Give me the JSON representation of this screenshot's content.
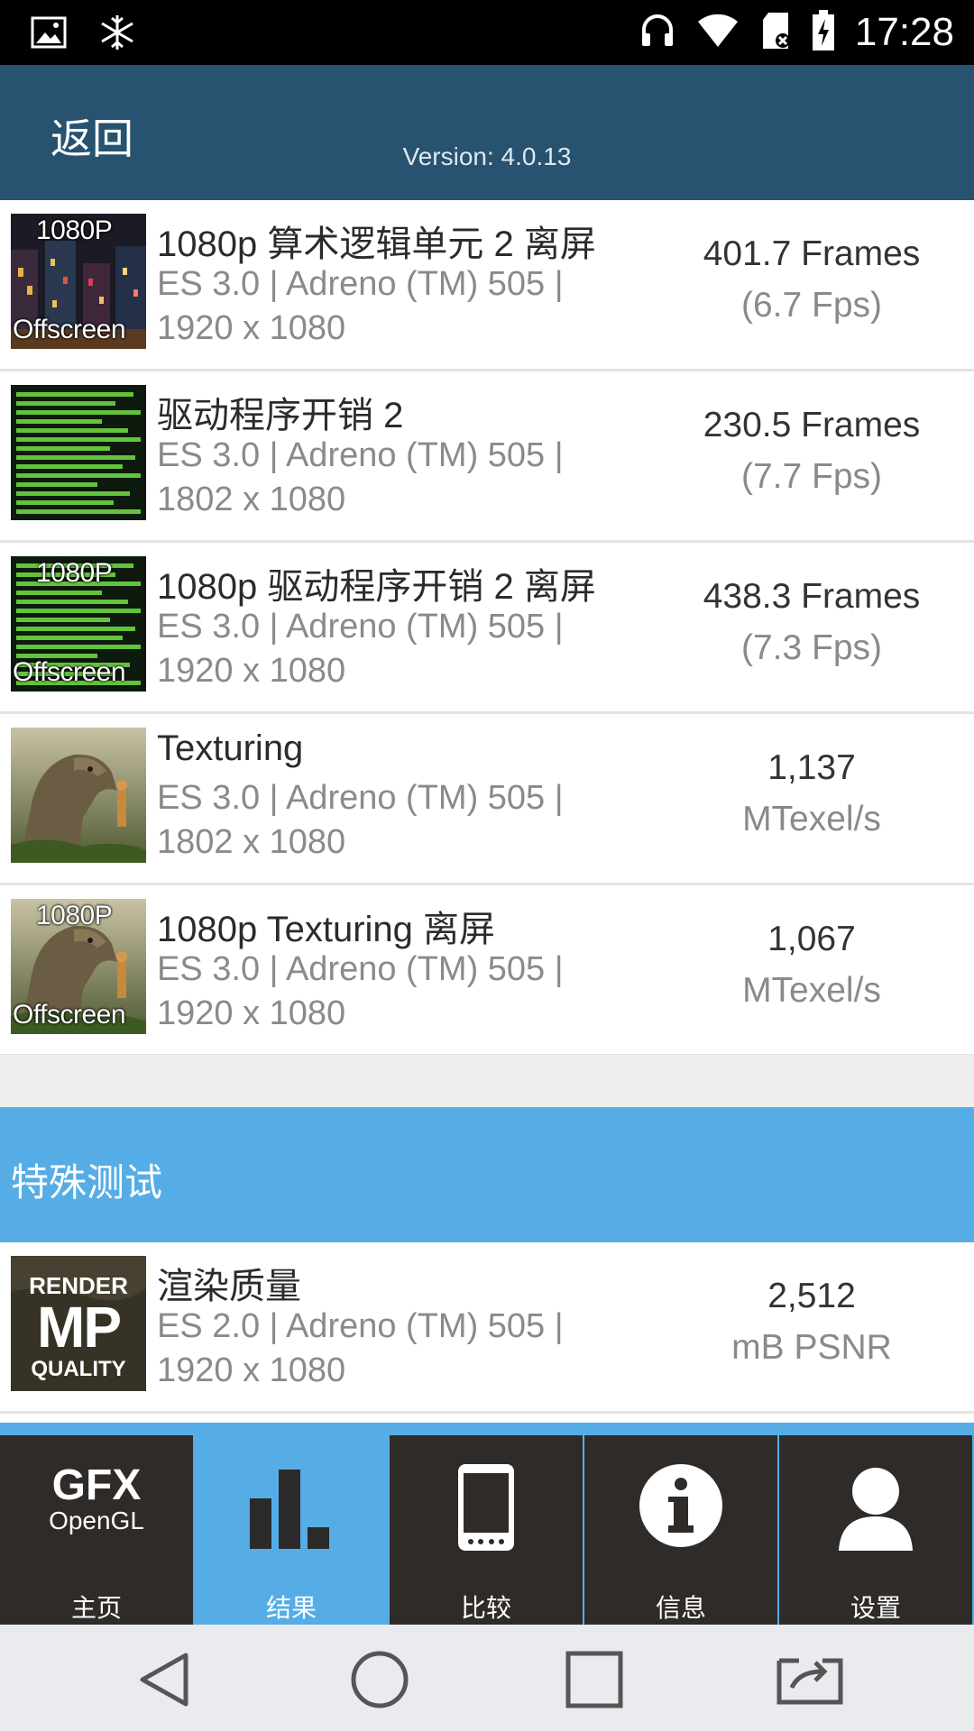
{
  "status_bar": {
    "time": "17:28",
    "icons": [
      "image-icon",
      "snowflake-icon",
      "headset-icon",
      "wifi-icon",
      "sd-card-icon",
      "battery-charging-icon"
    ]
  },
  "header": {
    "back_label": "返回",
    "version": "Version: 4.0.13"
  },
  "results": [
    {
      "title": "1080p 算术逻辑单元 2 离屏",
      "api": "ES 3.0 | Adreno (TM) 505 |",
      "resolution": "1920 x 1080",
      "value": "401.7 Frames",
      "unit": "(6.7 Fps)",
      "thumb": "city-night",
      "tag_top": "1080P",
      "tag_bottom": "Offscreen"
    },
    {
      "title": "驱动程序开销 2",
      "api": "ES 3.0 | Adreno (TM) 505 |",
      "resolution": "1802 x 1080",
      "value": "230.5 Frames",
      "unit": "(7.7 Fps)",
      "thumb": "green-bars",
      "tag_top": "",
      "tag_bottom": ""
    },
    {
      "title": "1080p 驱动程序开销 2 离屏",
      "api": "ES 3.0 | Adreno (TM) 505 |",
      "resolution": "1920 x 1080",
      "value": "438.3 Frames",
      "unit": "(7.3 Fps)",
      "thumb": "green-bars",
      "tag_top": "1080P",
      "tag_bottom": "Offscreen"
    },
    {
      "title": "Texturing",
      "api": "ES 3.0 | Adreno (TM) 505 |",
      "resolution": "1802 x 1080",
      "value": "1,137",
      "unit": "MTexel/s",
      "thumb": "dino",
      "tag_top": "",
      "tag_bottom": ""
    },
    {
      "title": "1080p Texturing 离屏",
      "api": "ES 3.0 | Adreno (TM) 505 |",
      "resolution": "1920 x 1080",
      "value": "1,067",
      "unit": "MTexel/s",
      "thumb": "dino",
      "tag_top": "1080P",
      "tag_bottom": "Offscreen"
    }
  ],
  "special_section": {
    "title": "特殊测试",
    "item": {
      "title": "渲染质量",
      "api": "ES 2.0 | Adreno (TM) 505 |",
      "resolution": "1920 x 1080",
      "value": "2,512",
      "unit": "mB PSNR",
      "thumb_lines": [
        "RENDER",
        "MP",
        "QUALITY"
      ]
    }
  },
  "tabs": [
    {
      "label": "主页",
      "icon": "gfx-opengl-logo",
      "logo_lines": [
        "GFX",
        "OpenGL"
      ],
      "active": false
    },
    {
      "label": "结果",
      "icon": "bar-chart-icon",
      "active": true
    },
    {
      "label": "比较",
      "icon": "phone-icon",
      "active": false
    },
    {
      "label": "信息",
      "icon": "info-icon",
      "active": false
    },
    {
      "label": "设置",
      "icon": "user-icon",
      "active": false
    }
  ],
  "nav_buttons": [
    "back-icon",
    "home-icon",
    "recents-icon",
    "screen-cast-icon"
  ],
  "colors": {
    "header": "#275270",
    "accent": "#56ade6",
    "tab_bg": "#2f2b29",
    "nav_bg": "#e9ebee"
  }
}
